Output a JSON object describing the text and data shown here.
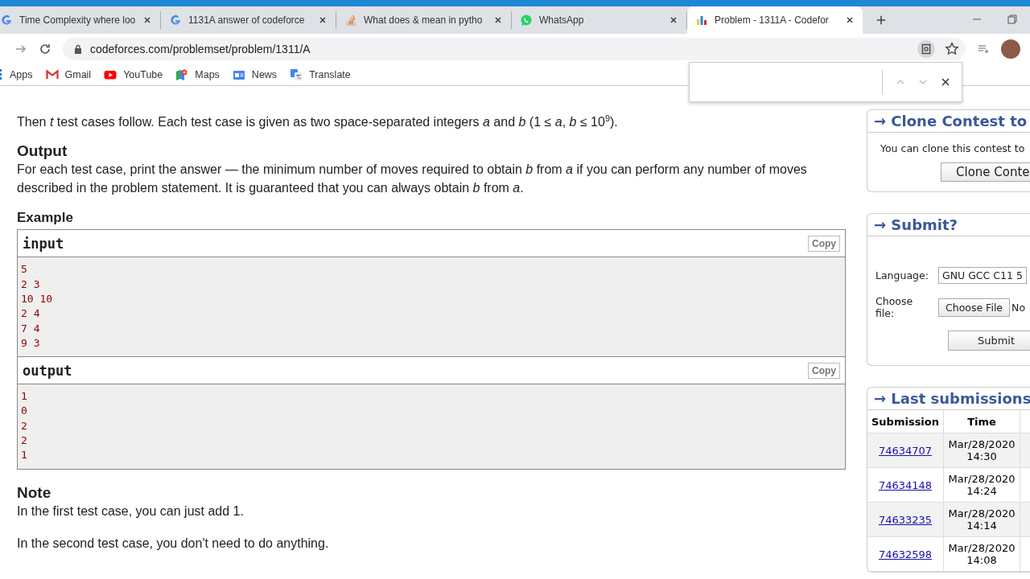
{
  "tabs": [
    {
      "title": "Time Complexity where loo",
      "kind": "google",
      "selected": false
    },
    {
      "title": "1131A answer of codeforce",
      "kind": "google",
      "selected": false
    },
    {
      "title": "What does & mean in pytho",
      "kind": "stack",
      "selected": false
    },
    {
      "title": "WhatsApp",
      "kind": "whatsapp",
      "selected": false
    },
    {
      "title": "Problem - 1311A - Codefor",
      "kind": "codeforces",
      "selected": true
    }
  ],
  "address_bar": {
    "url": "codeforces.com/problemset/problem/1311/A"
  },
  "bookmarks": [
    {
      "label": "Apps",
      "kind": "apps"
    },
    {
      "label": "Gmail",
      "kind": "gmail"
    },
    {
      "label": "YouTube",
      "kind": "youtube"
    },
    {
      "label": "Maps",
      "kind": "maps"
    },
    {
      "label": "News",
      "kind": "news"
    },
    {
      "label": "Translate",
      "kind": "translate"
    }
  ],
  "problem": {
    "intro": [
      "Then *t* test cases follow. Each test case is given as two space-separated integers *a* and *b* (1 ≤ *a*, *b* ≤ 10$^{9}$)."
    ],
    "output_title": "Output",
    "output_text": "For each test case, print the answer — the minimum number of moves required to obtain *b* from *a* if you can perform any number of moves described in the problem statement. It is guaranteed that you can always obtain *b* from *a*.",
    "example_title": "Example",
    "samples": [
      {
        "title": "input",
        "copy": "Copy",
        "lines": [
          "5",
          "2 3",
          "10 10",
          "2 4",
          "7 4",
          "9 3"
        ]
      },
      {
        "title": "output",
        "copy": "Copy",
        "lines": [
          "1",
          "0",
          "2",
          "2",
          "1"
        ]
      }
    ],
    "note_title": "Note",
    "notes": [
      "In the first test case, you can just add 1.",
      "In the second test case, you don't need to do anything."
    ]
  },
  "sidebar": {
    "clone": {
      "title": "→ Clone Contest to",
      "text": "You can clone this contest to",
      "button": "Clone Conte"
    },
    "submit": {
      "title": "→ Submit?",
      "language_label": "Language:",
      "language_value": "GNU GCC C11 5",
      "file_label": "Choose file:",
      "file_button": "Choose File",
      "file_status": "No",
      "button": "Submit"
    },
    "last": {
      "title": "→ Last submissions",
      "columns": [
        "Submission",
        "Time"
      ],
      "rows": [
        {
          "id": "74634707",
          "date": "Mar/28/2020",
          "time": "14:30"
        },
        {
          "id": "74634148",
          "date": "Mar/28/2020",
          "time": "14:24"
        },
        {
          "id": "74633235",
          "date": "Mar/28/2020",
          "time": "14:14"
        },
        {
          "id": "74632598",
          "date": "Mar/28/2020",
          "time": "14:08"
        }
      ]
    }
  }
}
